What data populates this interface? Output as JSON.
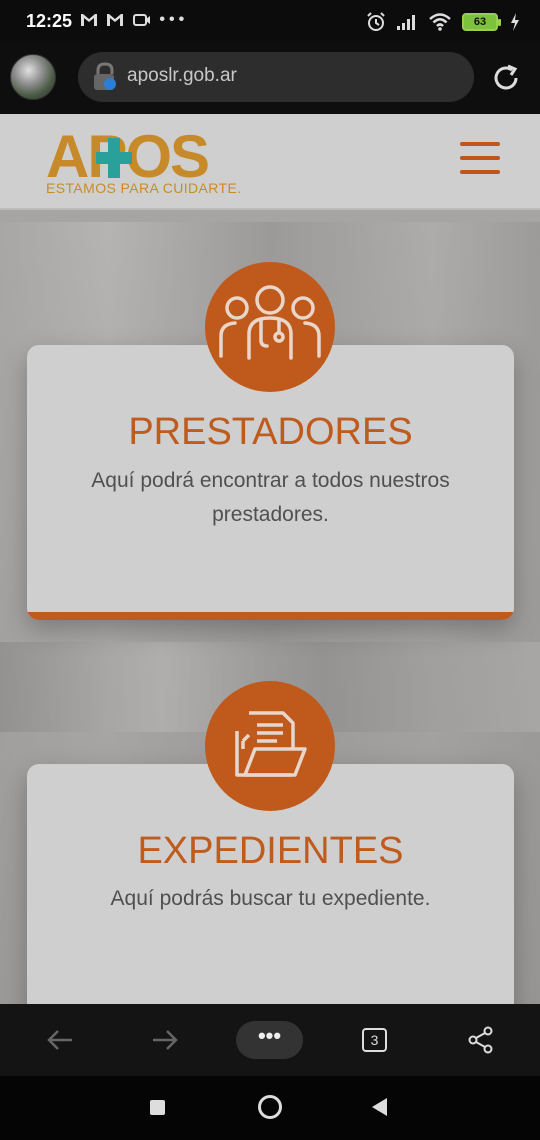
{
  "status_bar": {
    "time": "12:25",
    "left_icons": [
      "gmail-icon",
      "gmail-icon",
      "video-call-icon",
      "more-dots-icon"
    ],
    "right_icons": [
      "alarm-icon",
      "signal-icon",
      "wifi-icon",
      "battery-icon",
      "charging-icon"
    ],
    "battery_level": "63"
  },
  "browser": {
    "url": "aposlr.gob.ar",
    "tab_count": "3"
  },
  "site": {
    "logo_text": "APOS",
    "logo_tagline": "ESTAMOS PARA CUIDARTE.",
    "accent_color": "#be5b1d"
  },
  "cards": [
    {
      "icon": "doctors-icon",
      "title": "PRESTADORES",
      "description": "Aquí podrá encontrar a todos nuestros prestadores."
    },
    {
      "icon": "folder-documents-icon",
      "title": "EXPEDIENTES",
      "description": "Aquí podrás buscar tu expediente."
    }
  ],
  "bottom_bar": {
    "more_label": "•••"
  }
}
